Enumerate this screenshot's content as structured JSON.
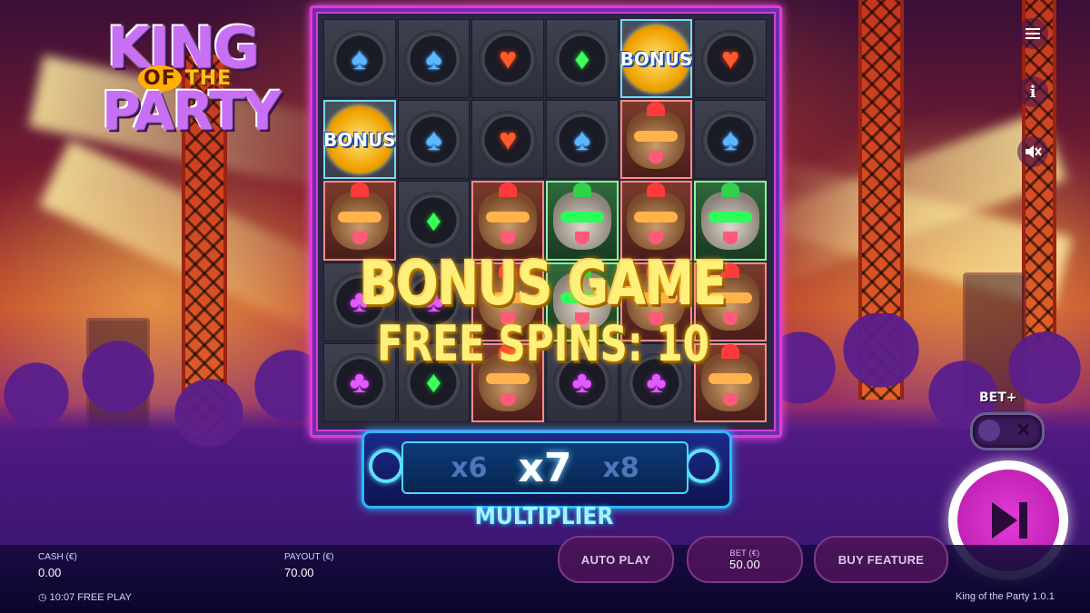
{
  "game": {
    "logo": {
      "line1": "KING",
      "of": "OF",
      "the": "THE",
      "line3": "PARTY"
    },
    "banner": {
      "title": "BONUS GAME",
      "free_spins": "FREE SPINS: 10"
    },
    "multiplier": {
      "prev": "x6",
      "current": "x7",
      "next": "x8",
      "label": "MULTIPLIER"
    },
    "bonus_label": "BONUS",
    "grid": [
      [
        "spade",
        "spade",
        "heart",
        "diamond",
        "bonus",
        "heart"
      ],
      [
        "bonus",
        "spade",
        "heart",
        "spade",
        "hyena",
        "spade"
      ],
      [
        "hyena",
        "diamond",
        "hyena",
        "wolf",
        "hyena",
        "wolf"
      ],
      [
        "club",
        "club",
        "hyena",
        "wolf",
        "hyena",
        "hyena"
      ],
      [
        "club",
        "diamond",
        "hyena",
        "club",
        "club",
        "hyena"
      ]
    ]
  },
  "controls": {
    "menu_icon": "menu-icon",
    "info_icon": "info-icon",
    "sound_icon": "sound-muted-icon",
    "bet_plus_label": "BET+",
    "spin_icon": "skip-forward-icon"
  },
  "bottom_bar": {
    "cash_label": "CASH (€)",
    "cash_value": "0.00",
    "payout_label": "PAYOUT (€)",
    "payout_value": "70.00",
    "clock": "10:07",
    "mode": "FREE PLAY",
    "auto_play": "AUTO PLAY",
    "bet_label": "BET (€)",
    "bet_value": "50.00",
    "buy_feature": "BUY FEATURE",
    "version": "King of the Party   1.0.1"
  }
}
